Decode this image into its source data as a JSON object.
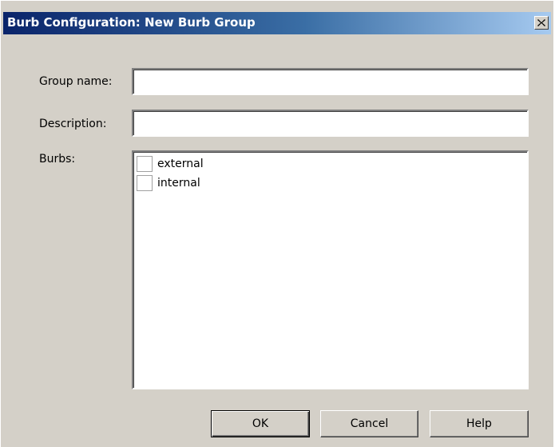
{
  "window": {
    "title": "Burb Configuration: New Burb Group",
    "close_icon": "close-icon"
  },
  "form": {
    "group_name_label": "Group name:",
    "group_name_value": "",
    "description_label": "Description:",
    "description_value": "",
    "burbs_label": "Burbs:"
  },
  "burbs": {
    "items": [
      {
        "label": "external",
        "checked": false
      },
      {
        "label": "internal",
        "checked": false
      }
    ]
  },
  "buttons": {
    "ok_label": "OK",
    "cancel_label": "Cancel",
    "help_label": "Help"
  }
}
